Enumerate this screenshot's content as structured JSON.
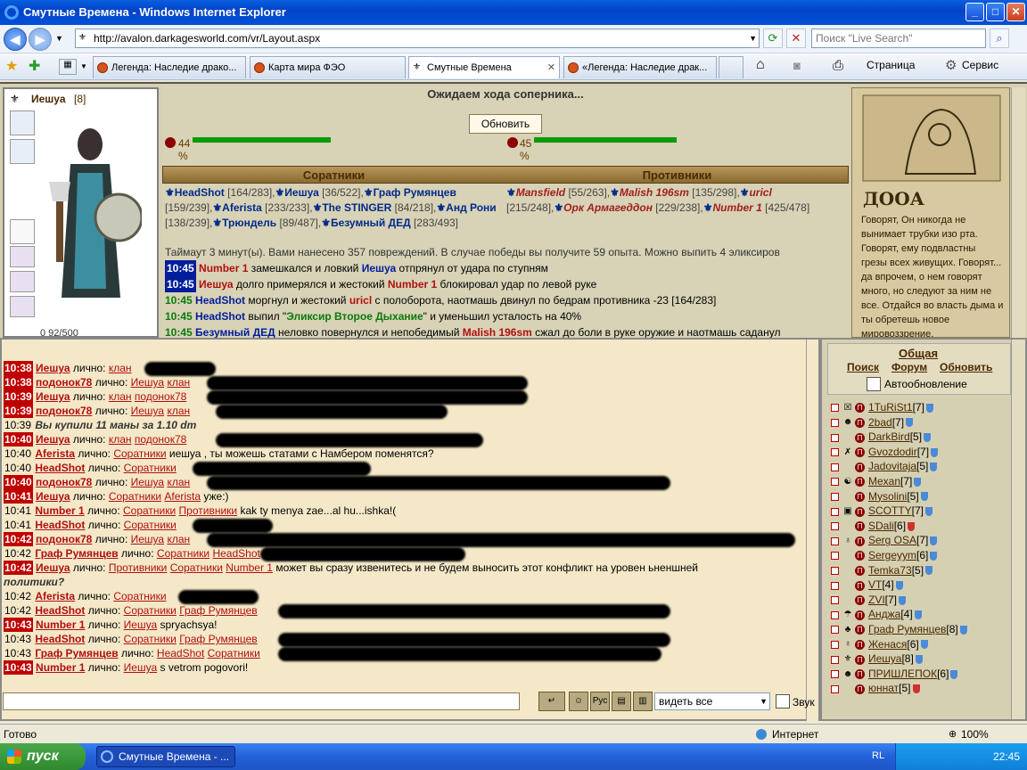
{
  "window": {
    "title": "Смутные Времена - Windows Internet Explorer"
  },
  "nav": {
    "url": "http://avalon.darkagesworld.com/vr/Layout.aspx",
    "search_placeholder": "Поиск \"Live Search\""
  },
  "tabs": [
    {
      "label": "Легенда: Наследие драко..."
    },
    {
      "label": "Карта мира ФЭО"
    },
    {
      "label": "Смутные Времена"
    },
    {
      "label": "«Легенда: Наследие драк..."
    }
  ],
  "commands": {
    "page": "Страница",
    "service": "Сервис"
  },
  "fight": {
    "status": "Ожидаем хода соперника...",
    "refresh": "Обновить",
    "hp_left": "44",
    "hp_left_pct": 0.43,
    "hp_right": "45",
    "hp_right_pct": 0.42,
    "pct": "%",
    "allies_header": "Соратники",
    "enemies_header": "Противники",
    "allies": [
      {
        "name": "HeadShot",
        "hp": "[164/283],"
      },
      {
        "name": "Иешуа",
        "hp": "[36/522],"
      },
      {
        "name": "Граф Румянцев",
        "hp": "[159/239],"
      },
      {
        "name": "Aferista",
        "hp": "[233/233],"
      },
      {
        "name": "The STINGER",
        "hp": "[84/218],"
      },
      {
        "name": "Анд Рони",
        "hp": "[138/239],"
      },
      {
        "name": "Трюндель",
        "hp": "[89/487],"
      },
      {
        "name": "Безумный ДЕД",
        "hp": "[283/493]"
      }
    ],
    "enemies": [
      {
        "name": "Mansfield",
        "hp": "[55/263],"
      },
      {
        "name": "Malish 196sm",
        "hp": "[135/298],"
      },
      {
        "name": "uricl",
        "hp": "[215/248],"
      },
      {
        "name": "Орк Армагеддон",
        "hp": "[229/238],"
      },
      {
        "name": "Number 1",
        "hp": "[425/478]"
      }
    ],
    "timeout_text": "Таймаут 3 минут(ы). Вами нанесено 357 повреждений. В случае победы вы получите 59 опыта. Можно выпить 4 эликсиров",
    "log": [
      {
        "time": "10:45",
        "a": "Number 1",
        "mid": " замешкался и ловкий ",
        "b": "Иешуа",
        "rest": " отпрянул от удара по ступням"
      },
      {
        "time": "10:45",
        "a": "Иешуа",
        "mid": " долго примерялся и жестокий ",
        "b": "Number 1",
        "rest": " блокировал удар по левой руке"
      },
      {
        "time": "10:45",
        "a": "HeadShot",
        "mid": " моргнул и жестокий ",
        "b": "uricl",
        "rest": " с полоборота, наотмашь двинул по бедрам противника -23 [164/283]"
      },
      {
        "time": "10:45",
        "a": "HeadShot",
        "mid": " выпил \"",
        "b": "Эликсир Второе Дыхание",
        "rest": "\" и уменьшил усталость на 40%"
      },
      {
        "time": "10:45",
        "a": "Безумный ДЕД",
        "mid": " неловко повернулся и непобедимый ",
        "b": "Malish 196sm",
        "rest": " сжал до боли в руке оружие и наотмашь саданул"
      }
    ]
  },
  "character": {
    "name": "Иешуа",
    "level": "[8]",
    "xp": "0    92/500"
  },
  "scroll": {
    "title": "ДООА",
    "text": "Говорят, Он никогда не вынимает трубки изо рта. Говорят, ему подвластны грезы всех живущих. Говорят... да впрочем, о нем говорят много, но следуют за ним не все. Отдайся во власть дыма и ты обретешь новое мировоззрение."
  },
  "chat": [
    {
      "time": "10:38",
      "red": true,
      "name": "Иешуа",
      "sep": " лично: ",
      "links": [
        "клан"
      ],
      "text": ""
    },
    {
      "time": "10:38",
      "red": true,
      "name": "подонок78",
      "sep": " лично: ",
      "links": [
        "Иешуа",
        "клан"
      ],
      "text": ""
    },
    {
      "time": "10:39",
      "red": true,
      "name": "Иешуа",
      "sep": " лично: ",
      "links": [
        "клан",
        "подонок78"
      ],
      "text": ""
    },
    {
      "time": "10:39",
      "red": true,
      "name": "подонок78",
      "sep": " лично: ",
      "links": [
        "Иешуа",
        "клан"
      ],
      "text": ""
    },
    {
      "time": "10:39",
      "red": false,
      "name": "",
      "sep": "",
      "links": [],
      "text": "Вы купили 11 маны за 1.10 dm"
    },
    {
      "time": "10:40",
      "red": true,
      "name": "Иешуа",
      "sep": " лично: ",
      "links": [
        "клан",
        "подонок78"
      ],
      "text": ""
    },
    {
      "time": "10:40",
      "red": false,
      "name": "Aferista",
      "sep": " лично: ",
      "links": [
        "Соратники"
      ],
      "text": "иешуа , ты можешь статами с Намбером поменятся?"
    },
    {
      "time": "10:40",
      "red": false,
      "name": "HeadShot",
      "sep": " лично: ",
      "links": [
        "Соратники"
      ],
      "text": ""
    },
    {
      "time": "10:40",
      "red": true,
      "name": "подонок78",
      "sep": " лично: ",
      "links": [
        "Иешуа",
        "клан"
      ],
      "text": ""
    },
    {
      "time": "10:41",
      "red": true,
      "name": "Иешуа",
      "sep": " лично: ",
      "links": [
        "Соратники",
        "Aferista"
      ],
      "text": "уже:)"
    },
    {
      "time": "10:41",
      "red": false,
      "name": "Number 1",
      "sep": " лично: ",
      "links": [
        "Соратники",
        "Противники"
      ],
      "text": "kak ty menya zae...al hu...ishka!("
    },
    {
      "time": "10:41",
      "red": false,
      "name": "HeadShot",
      "sep": " лично: ",
      "links": [
        "Соратники"
      ],
      "text": ""
    },
    {
      "time": "10:42",
      "red": true,
      "name": "подонок78",
      "sep": " лично: ",
      "links": [
        "Иешуа",
        "клан"
      ],
      "text": ""
    },
    {
      "time": "10:42",
      "red": false,
      "name": "Граф Румянцев",
      "sep": " лично: ",
      "links": [
        "Соратники",
        "HeadShot"
      ],
      "text": ""
    },
    {
      "time": "10:42",
      "red": true,
      "name": "Иешуа",
      "sep": " лично: ",
      "links": [
        "Противники",
        "Соратники",
        "Number 1"
      ],
      "text": "может вы сразу извенитесь и не будем выносить этот конфликт на уровен ьненшней"
    },
    {
      "time": "",
      "red": false,
      "name": "",
      "sep": "",
      "links": [],
      "text": "политики?"
    },
    {
      "time": "10:42",
      "red": false,
      "name": "Aferista",
      "sep": " лично: ",
      "links": [
        "Соратники"
      ],
      "text": ""
    },
    {
      "time": "10:42",
      "red": false,
      "name": "HeadShot",
      "sep": " лично: ",
      "links": [
        "Соратники",
        "Граф Румянцев"
      ],
      "text": ""
    },
    {
      "time": "10:43",
      "red": true,
      "name": "Number 1",
      "sep": " лично: ",
      "links": [
        "Иешуа"
      ],
      "text": "spryachsya!"
    },
    {
      "time": "10:43",
      "red": false,
      "name": "HeadShot",
      "sep": " лично: ",
      "links": [
        "Соратники",
        "Граф Румянцев"
      ],
      "text": ""
    },
    {
      "time": "10:43",
      "red": false,
      "name": "Граф Румянцев",
      "sep": " лично: ",
      "links": [
        "HeadShot",
        "Соратники"
      ],
      "text": ""
    },
    {
      "time": "10:43",
      "red": true,
      "name": "Number 1",
      "sep": " лично: ",
      "links": [
        "Иешуа"
      ],
      "text": "s vetrom pogovori!"
    }
  ],
  "chat_controls": {
    "view": "видеть все",
    "sound": "Звук"
  },
  "sidebar": {
    "general": "Общая",
    "search": "Поиск",
    "forum": "Форум",
    "refresh": "Обновить",
    "auto": "Автообновление",
    "users": [
      {
        "name": "1TuRiSt1",
        "lvl": "[7]"
      },
      {
        "name": "2bad",
        "lvl": "[7]"
      },
      {
        "name": "DarkBird",
        "lvl": "[5]"
      },
      {
        "name": "Gvozdodir",
        "lvl": "[7]"
      },
      {
        "name": "Jadovitaja",
        "lvl": "[5]"
      },
      {
        "name": "Mexan",
        "lvl": "[7]"
      },
      {
        "name": "Mysolini",
        "lvl": "[5]"
      },
      {
        "name": "SCOTTY",
        "lvl": "[7]"
      },
      {
        "name": "SDali",
        "lvl": "[6]"
      },
      {
        "name": "Serg OSA",
        "lvl": "[7]"
      },
      {
        "name": "Sergeyym",
        "lvl": "[6]"
      },
      {
        "name": "Temka73",
        "lvl": "[5]"
      },
      {
        "name": "VT",
        "lvl": "[4]"
      },
      {
        "name": "ZVI",
        "lvl": "[7]"
      },
      {
        "name": "Анджа",
        "lvl": "[4]"
      },
      {
        "name": "Граф Румянцев",
        "lvl": "[8]"
      },
      {
        "name": "Женася",
        "lvl": "[6]"
      },
      {
        "name": "Иешуа",
        "lvl": "[8]"
      },
      {
        "name": "ПРИШЛЕПОК",
        "lvl": "[6]"
      },
      {
        "name": "юннат",
        "lvl": "[5]"
      }
    ]
  },
  "statusbar": {
    "left": "Готово",
    "zone": "Интернет",
    "zoom": "100%"
  },
  "taskbar": {
    "start": "пуск",
    "task": "Смутные Времена - ...",
    "lang": "RL",
    "clock": "22:45"
  }
}
